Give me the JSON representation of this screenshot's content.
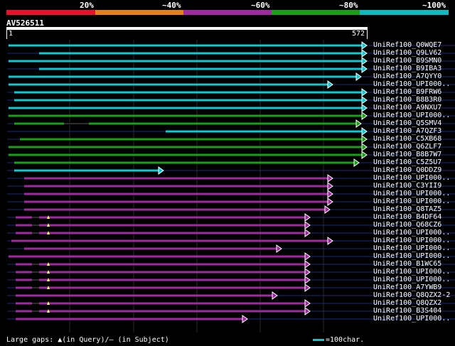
{
  "legend": {
    "labels": [
      "20%",
      "~40%",
      "~60%",
      "~80%",
      "~100%"
    ],
    "colors": [
      "#e8102a",
      "#e8801a",
      "#a02aa0",
      "#18a018",
      "#10b8c0"
    ]
  },
  "query": {
    "title": "AV526511",
    "start_label": "1",
    "end_label": "572"
  },
  "hits": [
    {
      "name": "UniRef100_Q0WQE7"
    },
    {
      "name": "UniRef100_Q9LV62"
    },
    {
      "name": "UniRef100_B9SMN0"
    },
    {
      "name": "UniRef100_B9IBA3"
    },
    {
      "name": "UniRef100_A7QYY0"
    },
    {
      "name": "UniRef100_UPI000.."
    },
    {
      "name": "UniRef100_B9FRW6"
    },
    {
      "name": "UniRef100_B8B3R0"
    },
    {
      "name": "UniRef100_A9NXU7"
    },
    {
      "name": "UniRef100_UPI000.."
    },
    {
      "name": "UniRef100_Q5SMV4"
    },
    {
      "name": "UniRef100_A7QZF3"
    },
    {
      "name": "UniRef100_C5XB68"
    },
    {
      "name": "UniRef100_Q6ZLF7"
    },
    {
      "name": "UniRef100_B8B7W7"
    },
    {
      "name": "UniRef100_C5Z5U7"
    },
    {
      "name": "UniRef100_Q0DDZ9"
    },
    {
      "name": "UniRef100_UPI000.."
    },
    {
      "name": "UniRef100_C3YII9"
    },
    {
      "name": "UniRef100_UPI000.."
    },
    {
      "name": "UniRef100_UPI000.."
    },
    {
      "name": "UniRef100_Q8TAZ5"
    },
    {
      "name": "UniRef100_B4DF64"
    },
    {
      "name": "UniRef100_Q68CZ6"
    },
    {
      "name": "UniRef100_UPI000.."
    },
    {
      "name": "UniRef100_UPI000.."
    },
    {
      "name": "UniRef100_UPI000.."
    },
    {
      "name": "UniRef100_UPI000.."
    },
    {
      "name": "UniRef100_B1WC65"
    },
    {
      "name": "UniRef100_UPI000.."
    },
    {
      "name": "UniRef100_UPI000.."
    },
    {
      "name": "UniRef100_A7YWB9"
    },
    {
      "name": "UniRef100_Q8QZX2-2"
    },
    {
      "name": "UniRef100_Q8QZX2"
    },
    {
      "name": "UniRef100_B3S404"
    },
    {
      "name": "UniRef100_UPI000.."
    }
  ],
  "footer": {
    "gaps_text": "Large gaps: ▲(in Query)/– (in Subject)",
    "scale_text": "=100char."
  }
}
